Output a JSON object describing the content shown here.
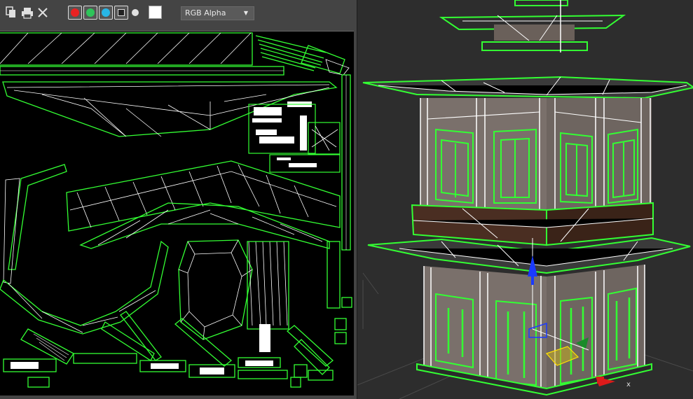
{
  "uv_toolbar": {
    "icons": [
      "copy-icon",
      "print-icon",
      "close-icon"
    ],
    "channels": [
      {
        "name": "red-channel-button",
        "color": "#e82222"
      },
      {
        "name": "green-channel-button",
        "color": "#2ec45a"
      },
      {
        "name": "blue-channel-button",
        "color": "#28b6e6"
      }
    ],
    "alpha_channel_icon": "alpha-channel-icon",
    "display_dot_icon": "dot-icon",
    "background_swatch_color": "#ffffff",
    "channel_select_value": "RGB Alpha"
  },
  "viewport": {
    "gizmo_axis_label": "x",
    "wire_color": "#33ff33",
    "wire_secondary_color": "#ffffff"
  }
}
